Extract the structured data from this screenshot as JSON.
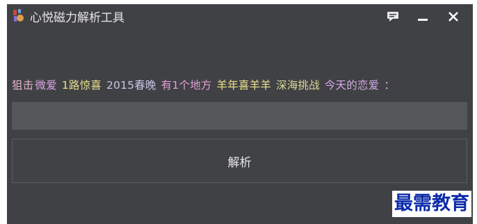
{
  "window": {
    "title": "心悦磁力解析工具",
    "icon": "app-logo-icon",
    "background": "#404144",
    "controls": {
      "chat_icon": "chat-bubble-icon",
      "minimize_icon": "minimize-icon",
      "close_icon": "close-icon"
    }
  },
  "ticker": {
    "lead": "狙击",
    "items": [
      {
        "label": "微爱",
        "color": "#d9a7e6"
      },
      {
        "label": "1路惊喜",
        "color": "#e8e08a"
      },
      {
        "label": "2015春晚",
        "color": "#c5c6e8"
      },
      {
        "label": "有1个地方",
        "color": "#e49fd6"
      },
      {
        "label": "羊年喜羊羊",
        "color": "#eae28d"
      },
      {
        "label": "深海挑战",
        "color": "#d9d79a"
      },
      {
        "label": "今天的恋爱",
        "color": "#d6a8e8"
      },
      {
        "label": "：",
        "color": "#d6a8e8"
      }
    ],
    "lead_color": "#e3b2c8"
  },
  "link_input": {
    "value": "",
    "placeholder": ""
  },
  "parse_button": {
    "label": "解析"
  },
  "watermark": {
    "text": "最需教育",
    "color": "#0b2ba8"
  }
}
